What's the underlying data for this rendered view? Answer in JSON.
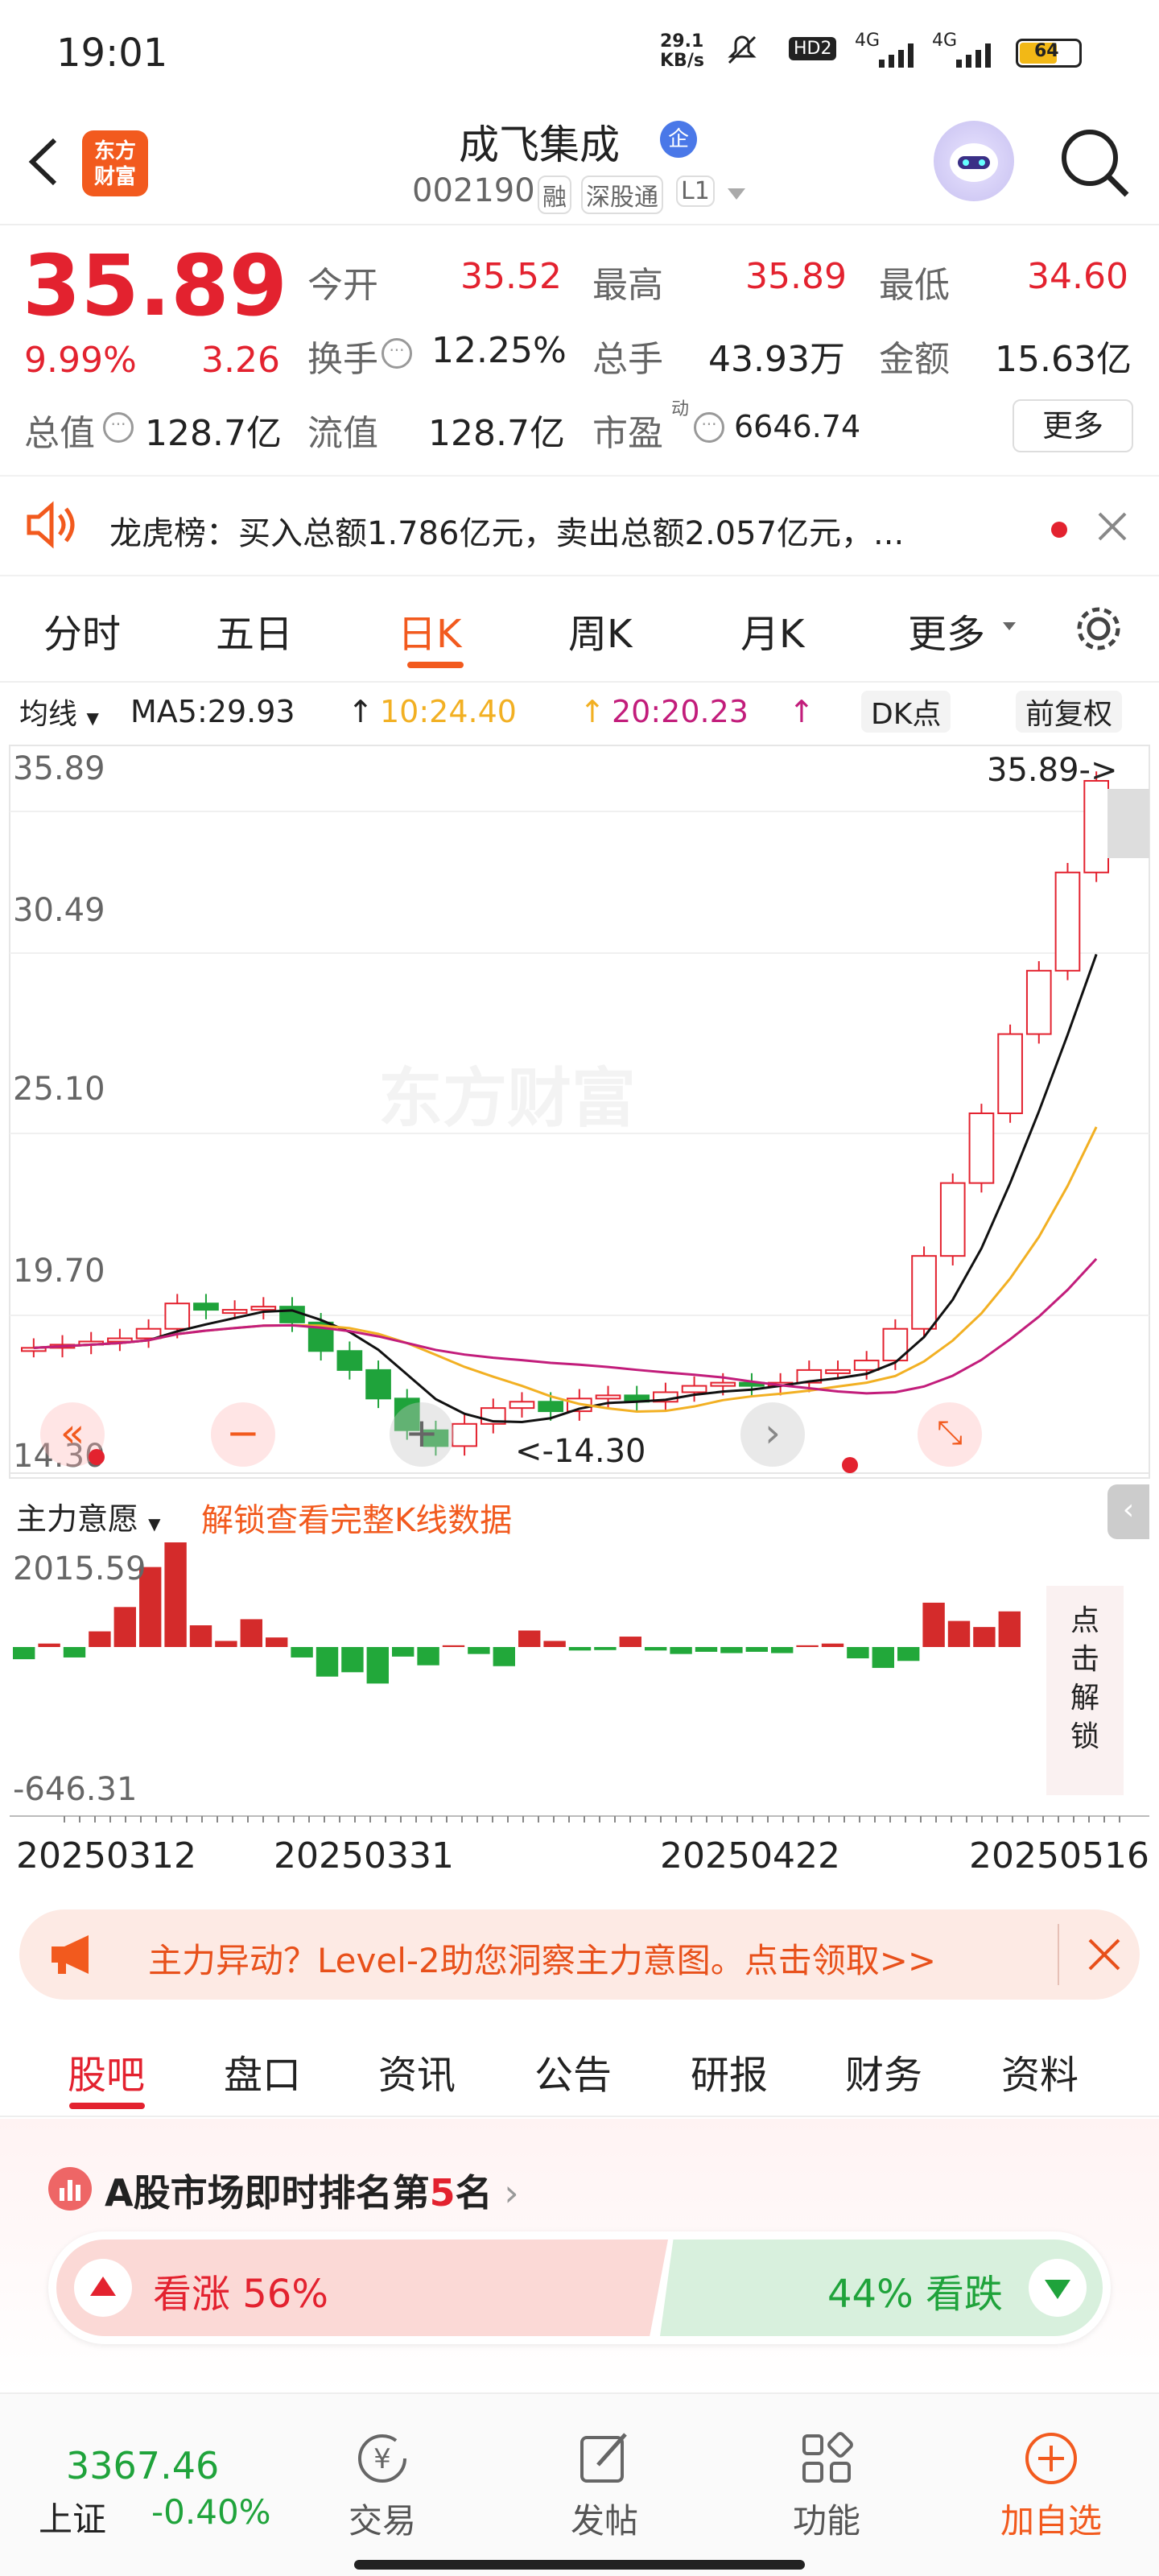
{
  "status": {
    "time": "19:01",
    "speed": "29.1\nKB/s",
    "hd": "HD2",
    "net1": "4G",
    "net2": "4G",
    "battery": "64"
  },
  "header": {
    "title": "成飞集成",
    "code": "002190",
    "tag1": "融",
    "tag2": "深股通",
    "tag3": "L1",
    "logo": "东方\n财富",
    "qi": "企"
  },
  "quote": {
    "price": "35.89",
    "pct": "9.99%",
    "chg": "3.26",
    "open_l": "今开",
    "open": "35.52",
    "high_l": "最高",
    "high": "35.89",
    "low_l": "最低",
    "low": "34.60",
    "turn_l": "换手",
    "turn": "12.25%",
    "vol_l": "总手",
    "vol": "43.93万",
    "amt_l": "金额",
    "amt": "15.63亿",
    "mcap_l": "总值",
    "mcap": "128.7亿",
    "fcap_l": "流值",
    "fcap": "128.7亿",
    "pe_l": "市盈",
    "pe_sup": "动",
    "pe": "6646.74",
    "more": "更多"
  },
  "notice": {
    "text": "龙虎榜：买入总额1.786亿元，卖出总额2.057亿元，..."
  },
  "tabs": [
    "分时",
    "五日",
    "日K",
    "周K",
    "月K",
    "更多"
  ],
  "chartbar": {
    "ma": "均线",
    "ma5": "MA5:29.93",
    "ma10": "10:24.40",
    "ma20": "20:20.23",
    "dk": "DK点",
    "fq": "前复权"
  },
  "kline": {
    "watermark": "东方财富",
    "ticks": [
      "35.89",
      "30.49",
      "25.10",
      "19.70",
      "14.30"
    ],
    "maxlabel": "35.89->",
    "minlabel": "<-14.30",
    "sub_label": "主力意愿",
    "unlock": "解锁查看完整K线数据",
    "sub_ticks": [
      "2015.59",
      "-646.31"
    ],
    "side": "点\n击\n解\n锁",
    "dates": [
      "20250312",
      "20250331",
      "20250422",
      "20250516"
    ]
  },
  "chart_data": {
    "type": "candlestick",
    "ylim": [
      14.3,
      35.89
    ],
    "last_close": 35.89,
    "ma_labels": [
      "MA5:29.93",
      "10:24.40",
      "20:20.23"
    ],
    "sub_ylim": [
      -646.31,
      2015.59
    ]
  },
  "promo": {
    "text": "主力异动？Level-2助您洞察主力意图。点击领取>>"
  },
  "subtabs": [
    "股吧",
    "盘口",
    "资讯",
    "公告",
    "研报",
    "财务",
    "资料"
  ],
  "rank": {
    "pre": "A股市场即时排名第",
    "num": "5",
    "post": "名",
    "up": "看涨 56%",
    "down": "44% 看跌"
  },
  "nav": {
    "index": "3367.46",
    "index_name": "上证",
    "index_chg": "-0.40%",
    "trade": "交易",
    "post": "发帖",
    "func": "功能",
    "add": "加自选"
  },
  "colors": {
    "up": "#e3222f",
    "down": "#1fa33b",
    "accent": "#ff5a1f"
  }
}
